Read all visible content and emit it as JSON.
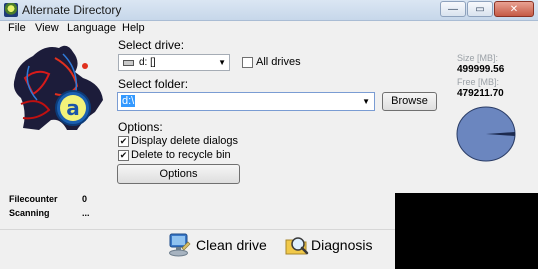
{
  "window": {
    "title": "Alternate Directory"
  },
  "menu": [
    "File",
    "View",
    "Language",
    "Help"
  ],
  "select_drive": {
    "label": "Select drive:",
    "value": "d: []",
    "all_drives_label": "All drives",
    "all_drives_checked": false
  },
  "select_folder": {
    "label": "Select folder:",
    "value": "d:\\",
    "browse_label": "Browse"
  },
  "options": {
    "label": "Options:",
    "items": [
      {
        "label": "Display delete dialogs",
        "checked": true
      },
      {
        "label": "Delete to recycle bin",
        "checked": true
      }
    ],
    "button_label": "Options"
  },
  "disk": {
    "size_label": "Size [MB]:",
    "size_value": "499999.56",
    "free_label": "Free [MB]:",
    "free_value": "479211.70",
    "colors": {
      "free": "#6b86bf",
      "used": "#1c2a4f"
    }
  },
  "counters": [
    {
      "label": "Filecounter",
      "value": "0"
    },
    {
      "label": "Scanning",
      "value": "..."
    }
  ],
  "actions": {
    "clean_label": "Clean drive",
    "diagnosis_label": "Diagnosis"
  }
}
